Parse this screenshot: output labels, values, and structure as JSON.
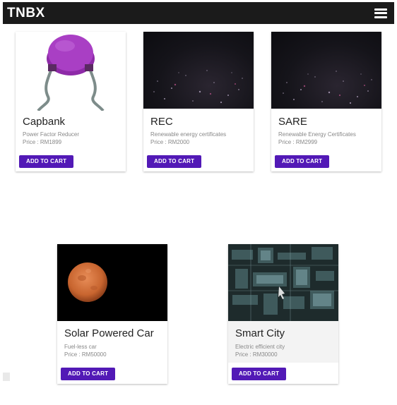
{
  "app": {
    "brand": "TNBX"
  },
  "products": [
    {
      "name": "Capbank",
      "description": "Power Factor Reducer",
      "price": "Price : RM1899",
      "button": "ADD TO CART",
      "image": "capacitor-image"
    },
    {
      "name": "REC",
      "description": "Renewable energy certificates",
      "price": "Price : RM2000",
      "button": "ADD TO CART",
      "image": "sparkle-dark-image"
    },
    {
      "name": "SARE",
      "description": "Renewable Energy Certificates",
      "price": "Price : RM2999",
      "button": "ADD TO CART",
      "image": "sparkle-dark-image"
    },
    {
      "name": "Solar Powered Car",
      "description": "Fuel-less car",
      "price": "Price : RM50000",
      "button": "ADD TO CART",
      "image": "moon-image"
    },
    {
      "name": "Smart City",
      "description": "Electric efficient city",
      "price": "Price : RM30000",
      "button": "ADD TO CART",
      "image": "circuit-board-image"
    }
  ],
  "colors": {
    "navbar": "#1b1b1b",
    "button": "#5219b6",
    "accent_purple": "#9a2fb8"
  }
}
